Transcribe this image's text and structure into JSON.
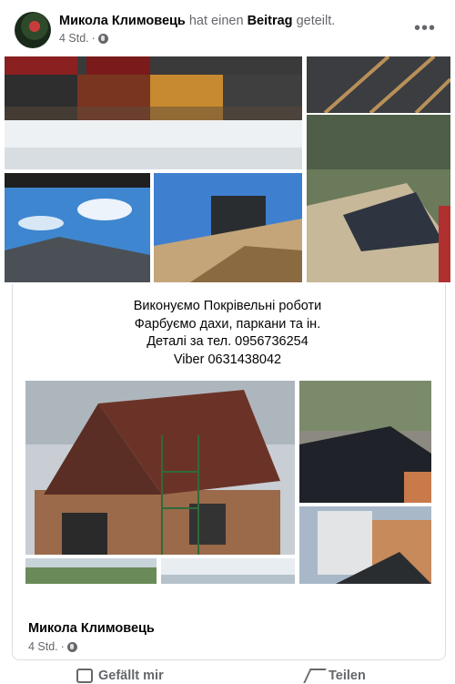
{
  "post": {
    "author": "Микола Климовець",
    "action_prefix": " hat einen ",
    "action_object": "Beitrag",
    "action_suffix": " geteilt.",
    "time": "4 Std.",
    "more": "•••"
  },
  "shared": {
    "lines": [
      "Виконуємо Покрівельні роботи",
      "Фарбуємо дахи, паркани та ін.",
      "Деталі за тел. 0956736254",
      "Viber 0631438042"
    ],
    "author": "Микола Климовець",
    "time": "4 Std."
  },
  "actions": {
    "like": "Gefällt mir",
    "share": "Teilen"
  },
  "colors": {
    "text": "#050505",
    "secondary": "#65676b",
    "border": "#dadde1"
  },
  "icons": [
    "globe-icon",
    "more-options-icon",
    "like-icon",
    "share-icon"
  ]
}
